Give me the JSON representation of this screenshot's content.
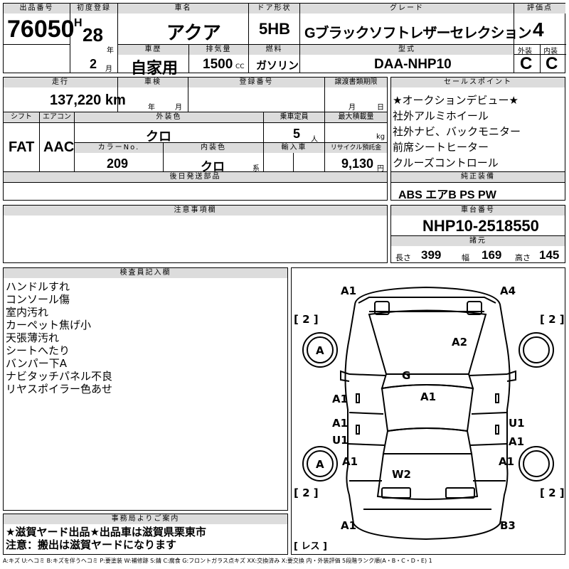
{
  "header": {
    "lot_label": "出品番号",
    "lot": "76050",
    "first_reg_label": "初度登録",
    "era": "H",
    "year": "28",
    "year_unit": "年",
    "month": "2",
    "month_unit": "月",
    "name_label": "車名",
    "name": "アクア",
    "door_label": "ドア形状",
    "door": "5HB",
    "grade_label": "グレード",
    "grade": "Gブラックソフトレザーセレクション",
    "score_label": "評価点",
    "score": "4",
    "ext_label": "外装",
    "int_label": "内装",
    "ext": "C",
    "int": "C",
    "history_label": "車歴",
    "history": "自家用",
    "disp_label": "排気量",
    "disp": "1500",
    "disp_unit": "CC",
    "fuel_label": "燃料",
    "fuel": "ガソリン",
    "model_label": "型式",
    "model": "DAA-NHP10"
  },
  "row2": {
    "mileage_label": "走行",
    "mileage": "137,220 km",
    "inspect_label": "車検",
    "inspect_y": "年",
    "inspect_m": "月",
    "reg_label": "登録番号",
    "transfer_label": "譲渡書類期限",
    "transfer_m": "月",
    "transfer_d": "日",
    "shift_label": "シフト",
    "shift": "FAT",
    "ac_label": "エアコン",
    "ac": "AAC",
    "color_label": "外装色",
    "color": "クロ",
    "capacity_label": "乗車定員",
    "capacity": "5",
    "capacity_unit": "人",
    "load_label": "最大積載量",
    "load_unit": "kg",
    "colorno_label": "カラーNo.",
    "colorno": "209",
    "intcolor_label": "内装色",
    "intcolor": "クロ",
    "intcolor_unit": "系",
    "import_label": "輸入車",
    "recycle_label": "リサイクル預託金",
    "recycle": "9,130",
    "recycle_unit": "円",
    "later_label": "後日発送部品"
  },
  "sales": {
    "label": "セールスポイント",
    "points": [
      "★オークションデビュー★",
      "社外アルミホイール",
      "社外ナビ、バックモニター",
      "前席シートヒーター",
      "クルーズコントロール"
    ]
  },
  "equip": {
    "label": "純正装備",
    "items": "ABS エアB PS PW"
  },
  "notes_box": {
    "label": "注意事項欄"
  },
  "chassis": {
    "label": "車台番号",
    "number": "NHP10-2518550",
    "spec_label": "諸元",
    "len_label": "長さ",
    "len": "399",
    "wid_label": "幅",
    "wid": "169",
    "hgt_label": "高さ",
    "hgt": "145"
  },
  "inspector": {
    "label": "検査員記入欄",
    "notes": [
      "ハンドルすれ",
      "コンソール傷",
      "室内汚れ",
      "カーペット焦げ小",
      "天張薄汚れ",
      "シートへたり",
      "バンパー下A",
      "ナビタッチパネル不良",
      "リヤスポイラー色あせ"
    ]
  },
  "office": {
    "label": "事務局よりご案内",
    "lines": [
      "★滋賀ヤード出品★出品車は滋賀県栗東市",
      "注意：搬出は滋賀ヤードになります"
    ]
  },
  "diagram": {
    "marks": {
      "front_left": "A1",
      "front_right": "A4",
      "hood": "A2",
      "roof_g": "G",
      "roof": "A1",
      "door_l1": "A1",
      "door_l2": "A1",
      "door_l3": "U1",
      "rear_left": "A1",
      "door_r1": "U1",
      "door_r2": "A1",
      "rear_right": "A1",
      "trunk": "W2",
      "wheel_fl": "A",
      "wheel_rl": "A",
      "bottom_left": "A1",
      "bottom_right": "B3"
    },
    "tire_fl": "[ 2 ]",
    "tire_fr": "[ 2 ]",
    "tire_rl": "[ 2 ]",
    "tire_rr": "[ 2 ]",
    "spare": "[ レス ]"
  },
  "legend": "A:キズ U:ヘコミ B:キズを伴うヘコミ P:要塗装 W:補修跡 S:錆 C:腐食 G:フロントガラス点キズ XX:交換済み X:要交換 内・外装評価 5段階ランク順(A・B・C・D・E) 1"
}
